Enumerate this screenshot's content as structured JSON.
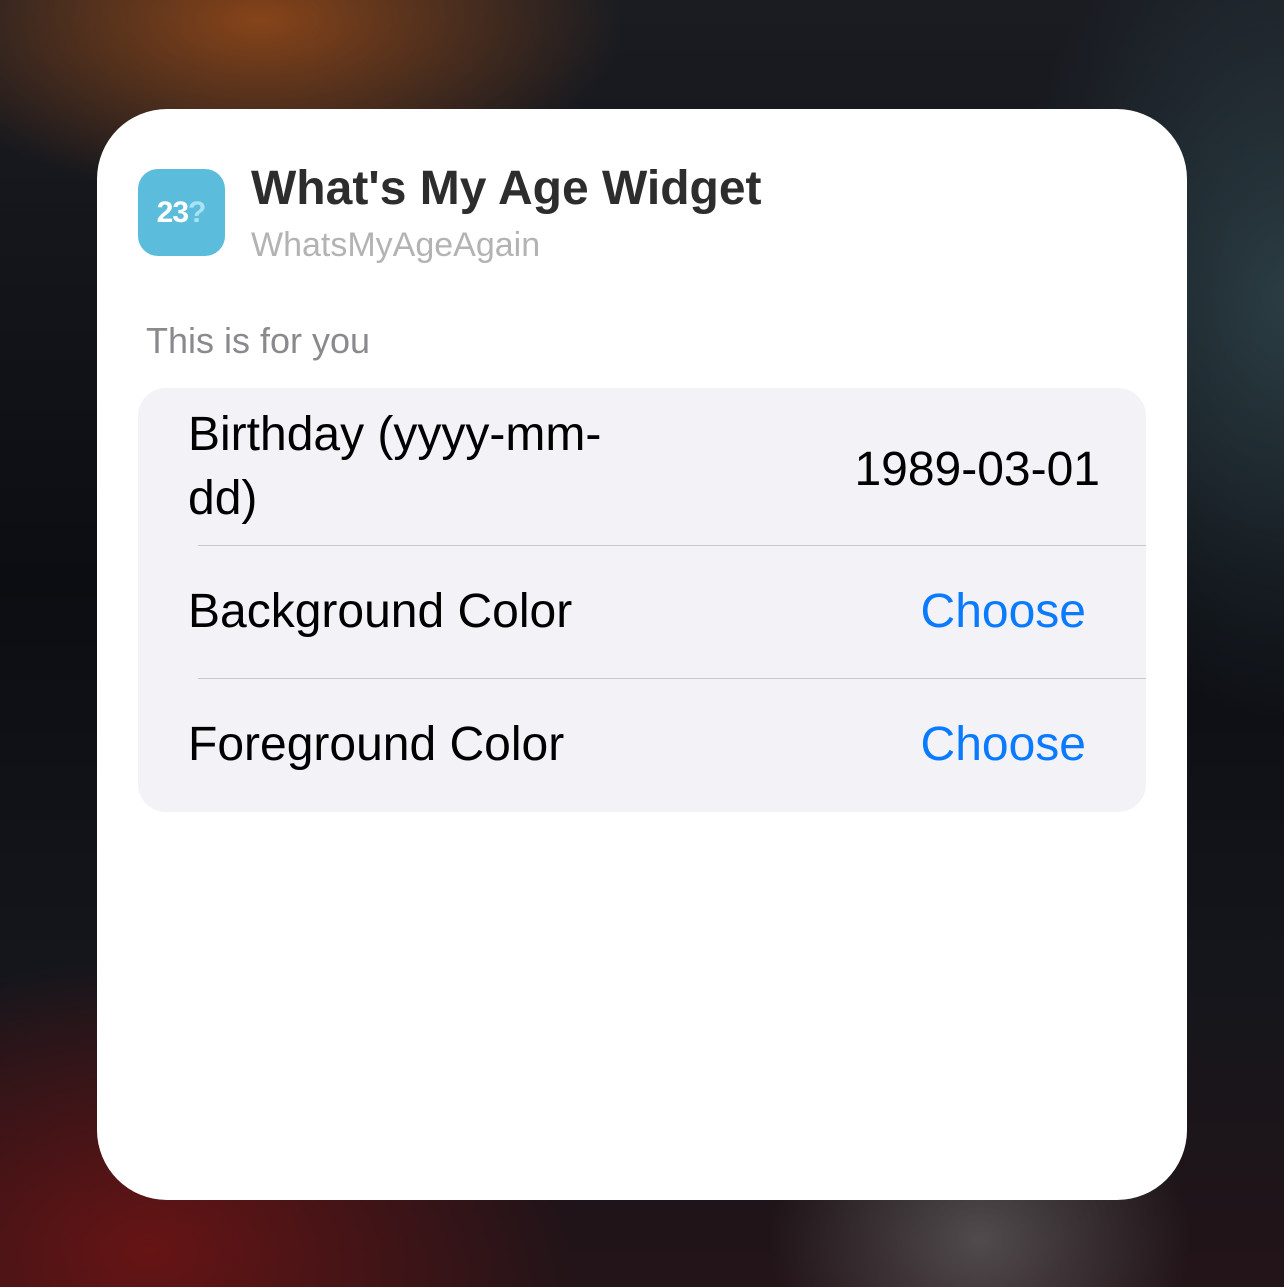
{
  "widget": {
    "title": "What's My Age Widget",
    "app_name": "WhatsMyAgeAgain",
    "icon": {
      "name": "app-icon-23",
      "number": "23",
      "glyph": "?",
      "color": "#5bbcdc"
    }
  },
  "section": {
    "header": "This is for you"
  },
  "settings": {
    "birthday": {
      "label": "Birthday (yyyy-mm-dd)",
      "value": "1989-03-01"
    },
    "background_color": {
      "label": "Background Color",
      "action": "Choose"
    },
    "foreground_color": {
      "label": "Foreground Color",
      "action": "Choose"
    }
  },
  "colors": {
    "accent": "#0a7aff",
    "group_background": "#f2f2f7"
  }
}
